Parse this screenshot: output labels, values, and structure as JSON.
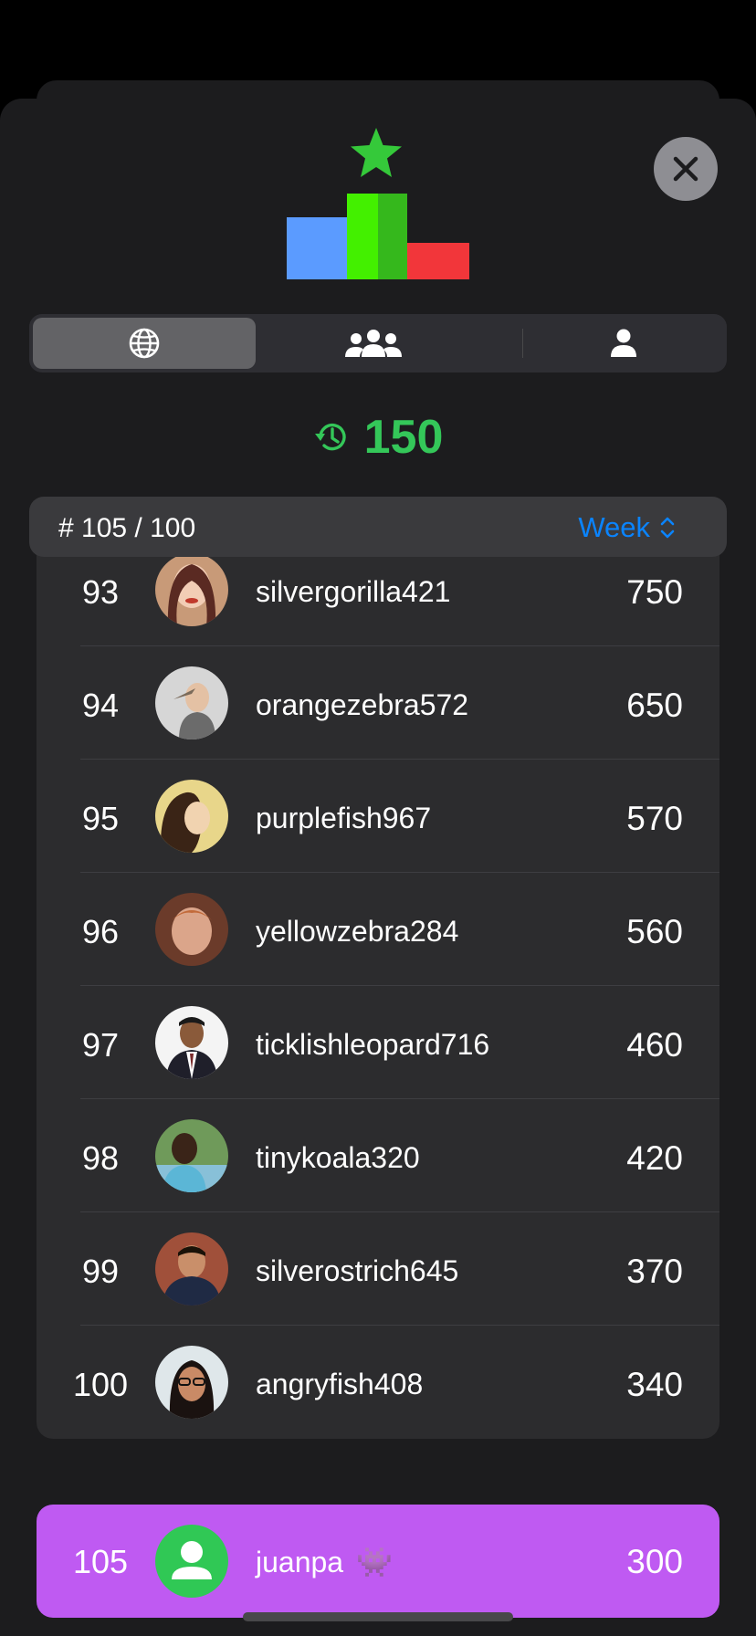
{
  "header": {
    "close_icon": "close-icon",
    "logo_icon": "leaderboard-podium-star-icon"
  },
  "tabs": [
    {
      "name": "global",
      "icon": "globe-icon",
      "active": true
    },
    {
      "name": "friends",
      "icon": "group-icon",
      "active": false
    },
    {
      "name": "me",
      "icon": "person-icon",
      "active": false
    }
  ],
  "streak": {
    "icon": "history-clock-icon",
    "value": "150",
    "color": "#34c759"
  },
  "leaderboard": {
    "rank_info": "# 105 / 100",
    "period": "Week",
    "accent": "#0a84ff",
    "rows": [
      {
        "rank": "93",
        "name": "silvergorilla421",
        "score": "750",
        "avatar": "avatar-photo"
      },
      {
        "rank": "94",
        "name": "orangezebra572",
        "score": "650",
        "avatar": "avatar-photo"
      },
      {
        "rank": "95",
        "name": "purplefish967",
        "score": "570",
        "avatar": "avatar-photo"
      },
      {
        "rank": "96",
        "name": "yellowzebra284",
        "score": "560",
        "avatar": "avatar-photo"
      },
      {
        "rank": "97",
        "name": "ticklishleopard716",
        "score": "460",
        "avatar": "avatar-photo"
      },
      {
        "rank": "98",
        "name": "tinykoala320",
        "score": "420",
        "avatar": "avatar-photo"
      },
      {
        "rank": "99",
        "name": "silverostrich645",
        "score": "370",
        "avatar": "avatar-photo"
      },
      {
        "rank": "100",
        "name": "angryfish408",
        "score": "340",
        "avatar": "avatar-photo"
      }
    ]
  },
  "current_user": {
    "rank": "105",
    "name": "juanpa",
    "badge": "👾",
    "score": "300",
    "color": "#bf5af2"
  }
}
